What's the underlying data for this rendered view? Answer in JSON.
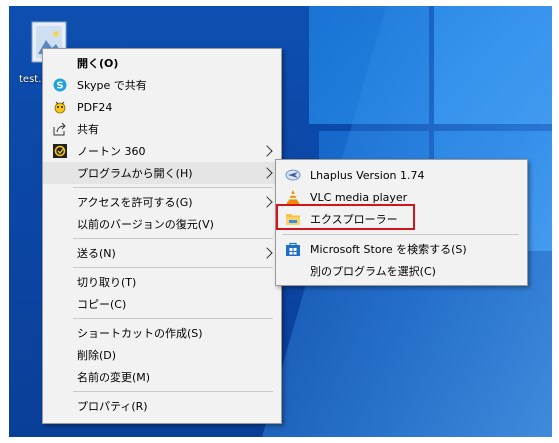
{
  "desktop": {
    "file_label": "test.t"
  },
  "context_menu": {
    "items": [
      {
        "label": "開く(O)",
        "icon": "none"
      },
      {
        "label": "Skype で共有",
        "icon": "skype-icon"
      },
      {
        "label": "PDF24",
        "icon": "pdf24-icon"
      },
      {
        "label": "共有",
        "icon": "share-icon"
      },
      {
        "label": "ノートン 360",
        "icon": "norton-icon"
      },
      {
        "label": "プログラムから開く(H)",
        "icon": "none"
      },
      {
        "label": "アクセスを許可する(G)",
        "icon": "none"
      },
      {
        "label": "以前のバージョンの復元(V)",
        "icon": "none"
      },
      {
        "label": "送る(N)",
        "icon": "none"
      },
      {
        "label": "切り取り(T)",
        "icon": "none"
      },
      {
        "label": "コピー(C)",
        "icon": "none"
      },
      {
        "label": "ショートカットの作成(S)",
        "icon": "none"
      },
      {
        "label": "削除(D)",
        "icon": "none"
      },
      {
        "label": "名前の変更(M)",
        "icon": "none"
      },
      {
        "label": "プロパティ(R)",
        "icon": "none"
      }
    ]
  },
  "submenu": {
    "items": [
      {
        "label": "Lhaplus Version 1.74",
        "icon": "lhaplus-icon"
      },
      {
        "label": "VLC media player",
        "icon": "vlc-cone-icon"
      },
      {
        "label": "エクスプローラー",
        "icon": "folder-icon"
      },
      {
        "label": "Microsoft Store を検索する(S)",
        "icon": "store-icon"
      },
      {
        "label": "別のプログラムを選択(C)",
        "icon": "none"
      }
    ]
  },
  "colors": {
    "highlight_box": "#d4141b",
    "desktop_blue": "#0b47a6",
    "menu_bg": "#f2f2f2"
  }
}
